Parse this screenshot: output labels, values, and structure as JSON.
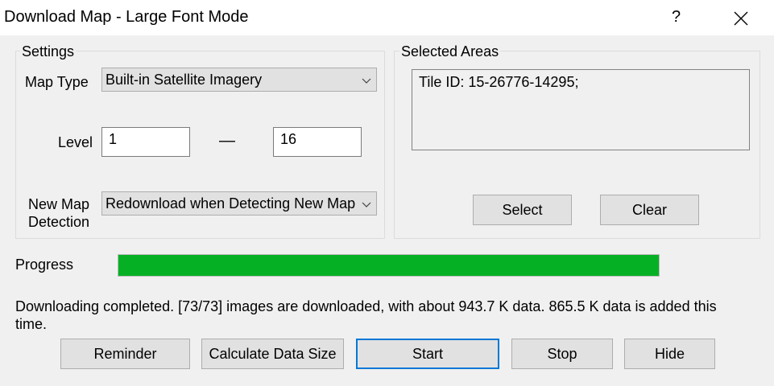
{
  "window": {
    "title": "Download Map - Large Font Mode",
    "help_label": "?",
    "close_icon": "close-icon"
  },
  "settings": {
    "legend": "Settings",
    "map_type_label": "Map Type",
    "map_type_value": "Built-in Satellite Imagery",
    "level_label": "Level",
    "level_from": "1",
    "level_separator": "—",
    "level_to": "16",
    "new_map_detection_label_line1": "New Map",
    "new_map_detection_label_line2": "Detection",
    "new_map_detection_value": "Redownload when Detecting New Map"
  },
  "selected_areas": {
    "legend": "Selected Areas",
    "items": [
      "Tile ID: 15-26776-14295;"
    ],
    "select_label": "Select",
    "clear_label": "Clear"
  },
  "progress": {
    "label": "Progress",
    "fraction": 1.0,
    "color": "#06b025"
  },
  "status": {
    "line1": "Downloading completed. [73/73] images are downloaded, with about 943.7 K data. 865.5 K data is added this",
    "line2": "time."
  },
  "buttons": {
    "reminder": "Reminder",
    "calc_size": "Calculate Data Size",
    "start": "Start",
    "stop": "Stop",
    "hide": "Hide"
  }
}
